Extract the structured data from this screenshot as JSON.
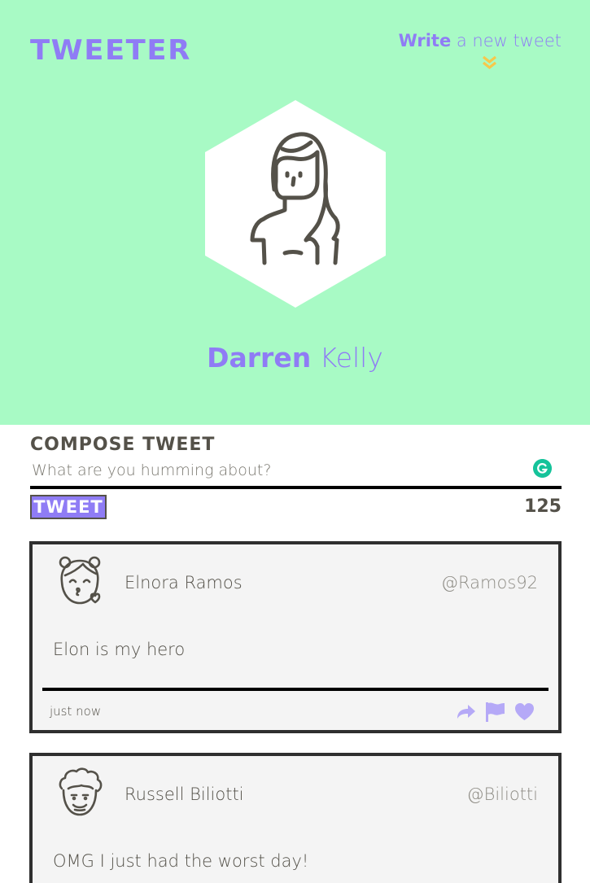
{
  "nav": {
    "brand": "Tweeter",
    "write_strong": "Write",
    "write_rest": " a new tweet"
  },
  "profile": {
    "first_name": "Darren",
    "last_name": " Kelly"
  },
  "compose": {
    "title": "Compose Tweet",
    "placeholder": "What are you humming about?",
    "button_label": "Tweet",
    "char_count": "125"
  },
  "tweets": [
    {
      "author": "Elnora Ramos",
      "handle": "@Ramos92",
      "content": "Elon is my hero",
      "timestamp": "just now"
    },
    {
      "author": "Russell Biliotti",
      "handle": "@Biliotti",
      "content": "OMG I just had the worst day!"
    }
  ],
  "colors": {
    "hero_bg": "#a8fac5",
    "accent": "#8f7cf5",
    "icon_accent": "#b5a9f7",
    "chevron": "#f6c84c",
    "text_dark": "#545149",
    "tweet_bg": "#f4f4f4",
    "grammarly": "#15c39a"
  }
}
